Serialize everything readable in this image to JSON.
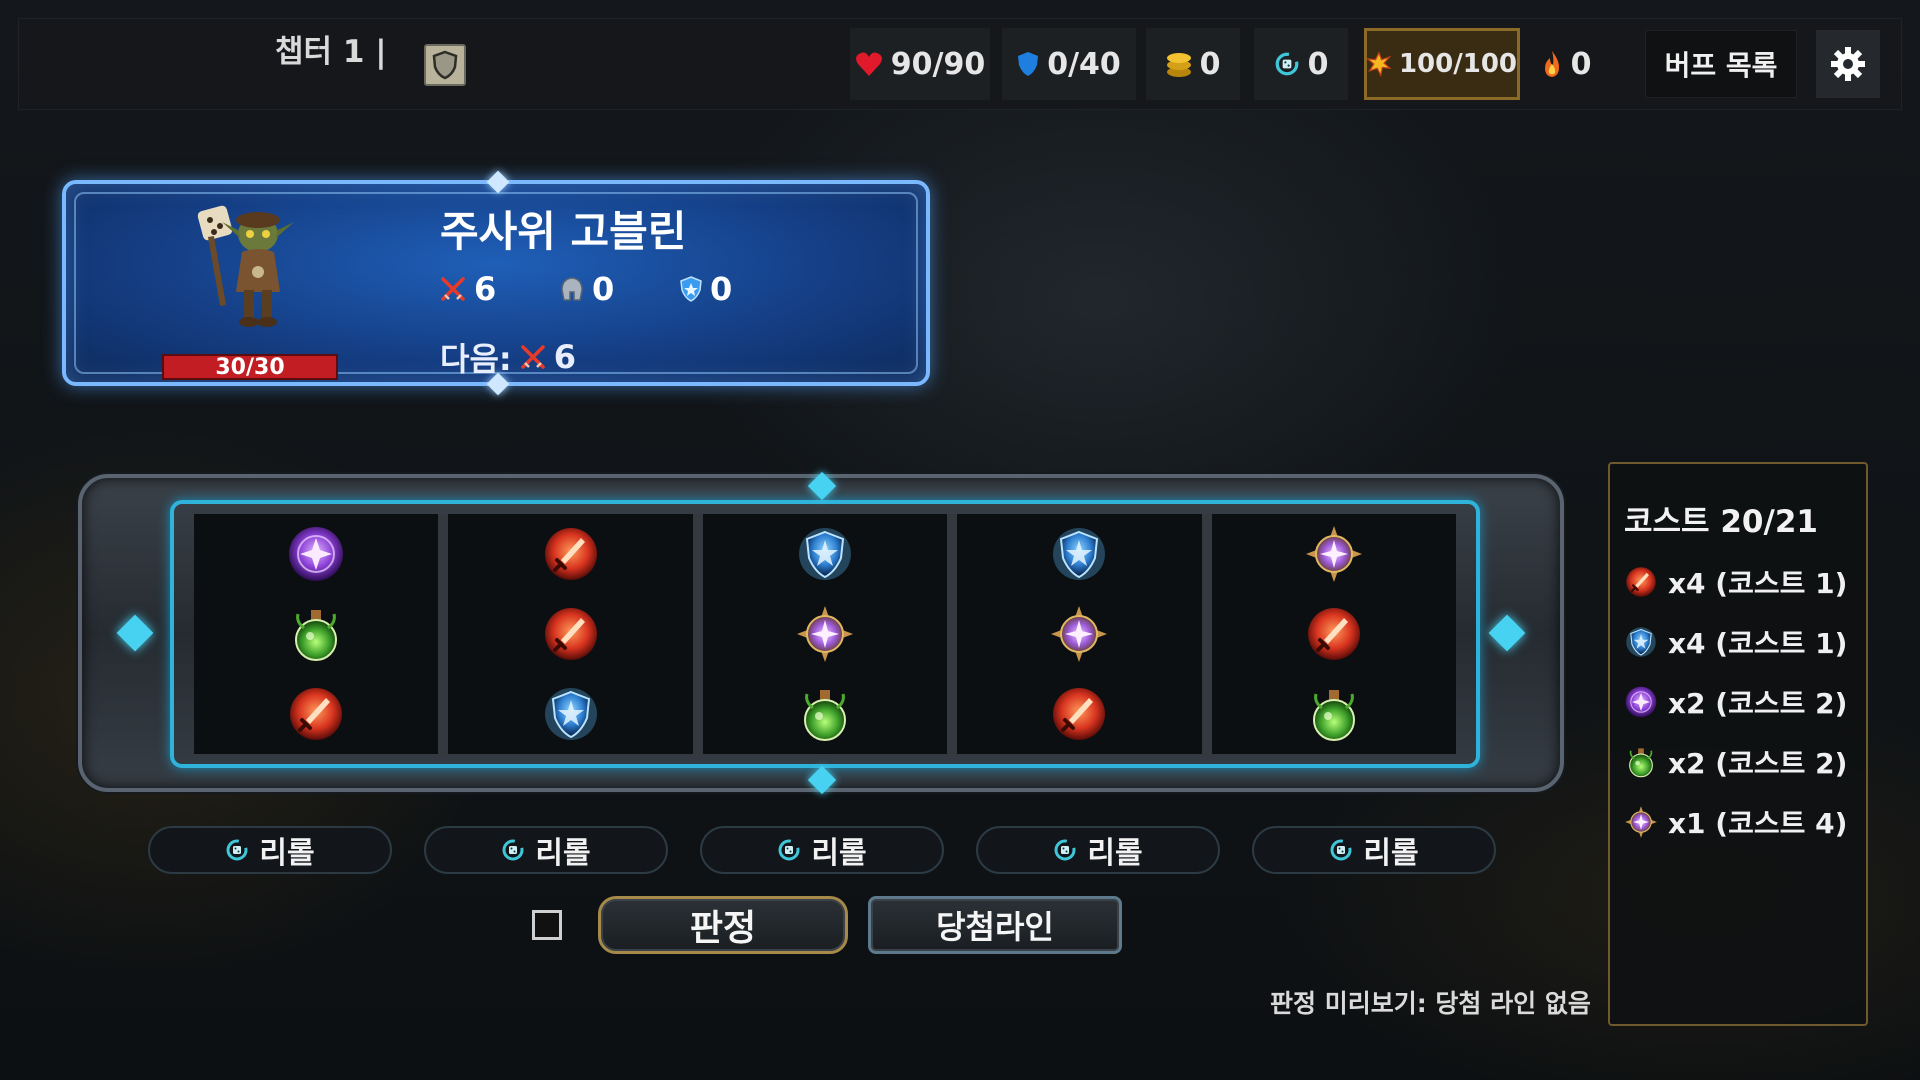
{
  "header": {
    "chapter": "챕터 1 |",
    "hp": "90/90",
    "shield": "0/40",
    "gold": "0",
    "rerolls": "0",
    "energy": "100/100",
    "fire": "0",
    "buff_button": "버프 목록"
  },
  "enemy": {
    "name": "주사위 고블린",
    "hp": "30/30",
    "attack": "6",
    "armor": "0",
    "shield": "0",
    "next_label": "다음:",
    "next_attack": "6"
  },
  "reels": [
    [
      "magic",
      "potion",
      "sword"
    ],
    [
      "sword",
      "sword",
      "shield"
    ],
    [
      "shield",
      "star",
      "potion"
    ],
    [
      "shield",
      "star",
      "sword"
    ],
    [
      "star",
      "sword",
      "potion"
    ]
  ],
  "reroll_label": "리롤",
  "actions": {
    "judge": "판정",
    "win_lines": "당첨라인",
    "preview": "판정 미리보기: 당첨 라인 없음"
  },
  "cost": {
    "title": "코스트 20/21",
    "items": [
      {
        "icon": "sword",
        "text": "x4 (코스트 1)"
      },
      {
        "icon": "shield",
        "text": "x4 (코스트 1)"
      },
      {
        "icon": "magic",
        "text": "x2 (코스트 2)"
      },
      {
        "icon": "potion",
        "text": "x2 (코스트 2)"
      },
      {
        "icon": "star",
        "text": "x1 (코스트 4)"
      }
    ]
  },
  "colors": {
    "sword": "#d8341f",
    "shield": "#2e7fd1",
    "magic": "#8a3fd6",
    "potion": "#3ea02a",
    "star": "#9c5ad8",
    "accent_cyan": "#2fb3da",
    "enemy_panel": "#1f5fb8"
  }
}
